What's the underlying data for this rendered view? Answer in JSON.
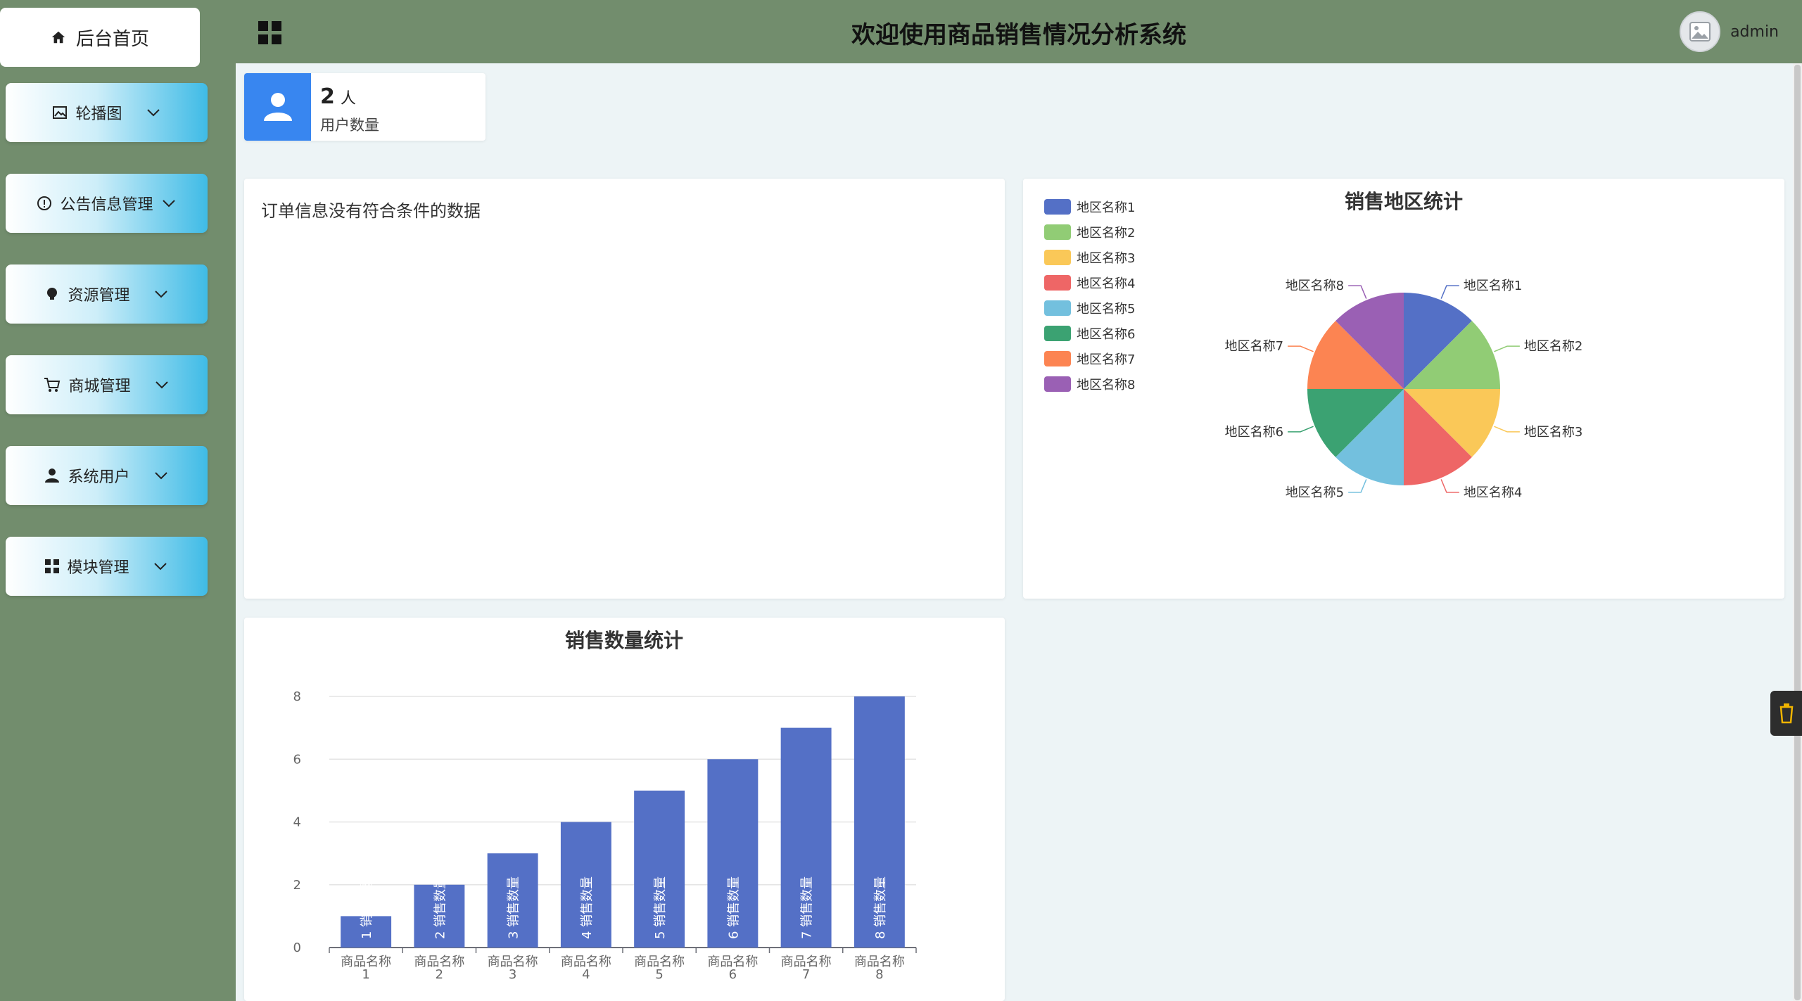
{
  "sidebar": {
    "home": "后台首页",
    "items": [
      {
        "label": "轮播图",
        "icon": "image-icon"
      },
      {
        "label": "公告信息管理",
        "icon": "info-circle-icon"
      },
      {
        "label": "资源管理",
        "icon": "bulb-icon"
      },
      {
        "label": "商城管理",
        "icon": "cart-icon"
      },
      {
        "label": "系统用户",
        "icon": "user-icon"
      },
      {
        "label": "模块管理",
        "icon": "grid-icon"
      }
    ]
  },
  "header": {
    "title": "欢迎使用商品销售情况分析系统",
    "username": "admin"
  },
  "user_card": {
    "count": "2",
    "unit": "人",
    "label": "用户数量"
  },
  "order_card": {
    "message": "订单信息没有符合条件的数据"
  },
  "colors": {
    "topbar": "#728d6d",
    "content_bg": "#edf4f6",
    "accent_blue": "#3886f0",
    "bar": "#5470c6"
  },
  "chart_data": [
    {
      "type": "pie",
      "title": "销售地区统计",
      "legend_position": "top-left",
      "slices": [
        {
          "name": "地区名称1",
          "value": 1,
          "color": "#5470c6"
        },
        {
          "name": "地区名称2",
          "value": 1,
          "color": "#91cc75"
        },
        {
          "name": "地区名称3",
          "value": 1,
          "color": "#fac858"
        },
        {
          "name": "地区名称4",
          "value": 1,
          "color": "#ee6666"
        },
        {
          "name": "地区名称5",
          "value": 1,
          "color": "#73c0de"
        },
        {
          "name": "地区名称6",
          "value": 1,
          "color": "#3ba272"
        },
        {
          "name": "地区名称7",
          "value": 1,
          "color": "#fc8452"
        },
        {
          "name": "地区名称8",
          "value": 1,
          "color": "#9a60b4"
        }
      ]
    },
    {
      "type": "bar",
      "title": "销售数量统计",
      "categories": [
        "商品名称1",
        "商品名称2",
        "商品名称3",
        "商品名称4",
        "商品名称5",
        "商品名称6",
        "商品名称7",
        "商品名称8"
      ],
      "values": [
        1,
        2,
        3,
        4,
        5,
        6,
        7,
        8
      ],
      "bar_label_prefix": "销售数量",
      "ylim": [
        0,
        8
      ],
      "yticks": [
        0,
        2,
        4,
        6,
        8
      ],
      "grid": true
    }
  ]
}
